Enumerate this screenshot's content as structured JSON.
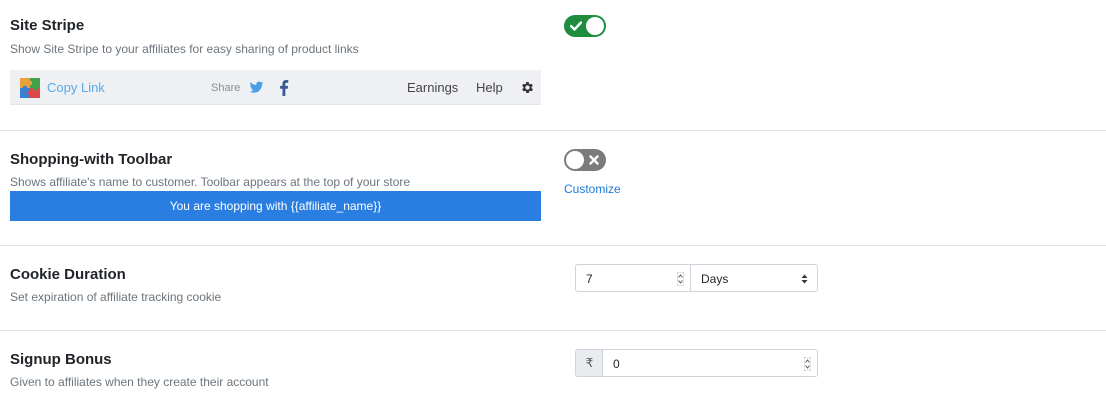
{
  "site_stripe": {
    "title": "Site Stripe",
    "description": "Show Site Stripe to your affiliates for easy sharing of product links",
    "enabled": true,
    "preview": {
      "copy_link_label": "Copy Link",
      "share_label": "Share",
      "earnings_label": "Earnings",
      "help_label": "Help"
    }
  },
  "shopping_toolbar": {
    "title": "Shopping-with Toolbar",
    "description": "Shows affiliate's name to customer. Toolbar appears at the top of your store",
    "enabled": false,
    "preview_text": "You are shopping with {{affiliate_name}}",
    "customize_label": "Customize"
  },
  "cookie_duration": {
    "title": "Cookie Duration",
    "description": "Set expiration of affiliate tracking cookie",
    "value": "7",
    "unit": "Days"
  },
  "signup_bonus": {
    "title": "Signup Bonus",
    "description": "Given to affiliates when they create their account",
    "currency_symbol": "₹",
    "value": "0"
  },
  "colors": {
    "toggle_on": "#1e8e3e",
    "toggle_off": "#7b7b7b",
    "toolbar_bg": "#2a7de1",
    "link": "#1f7ad6"
  }
}
